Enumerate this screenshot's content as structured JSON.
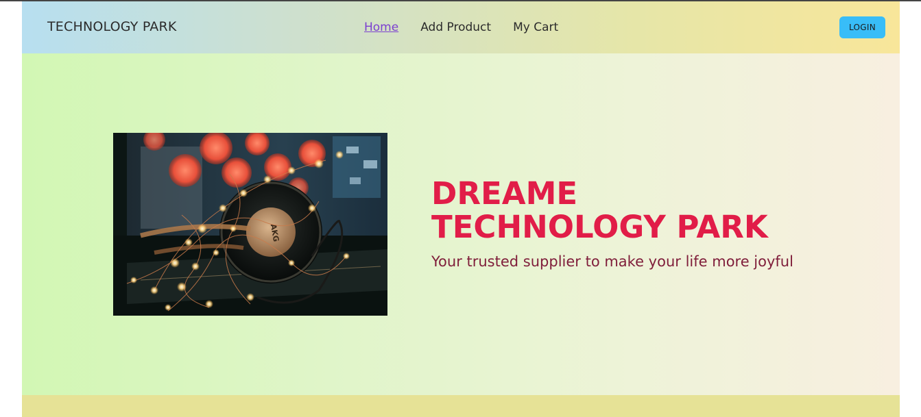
{
  "navbar": {
    "brand": "TECHNOLOGY PARK",
    "links": [
      {
        "label": "Home",
        "active": true
      },
      {
        "label": "Add Product",
        "active": false
      },
      {
        "label": "My Cart",
        "active": false
      }
    ],
    "login_label": "LOGIN"
  },
  "hero": {
    "title_line1": "DREAME",
    "title_line2": "TECHNOLOGY PARK",
    "subtitle": "Your trusted supplier to make your life more joyful",
    "image": {
      "depicts": "headphones-with-fairy-lights",
      "headphone_brand_text": "AKG"
    }
  },
  "colors": {
    "title": "#e11d48",
    "subtitle": "#7f1d3a",
    "login_button": "#38bdf8",
    "active_link": "#7b3fd0",
    "footer": "#e6e296"
  }
}
